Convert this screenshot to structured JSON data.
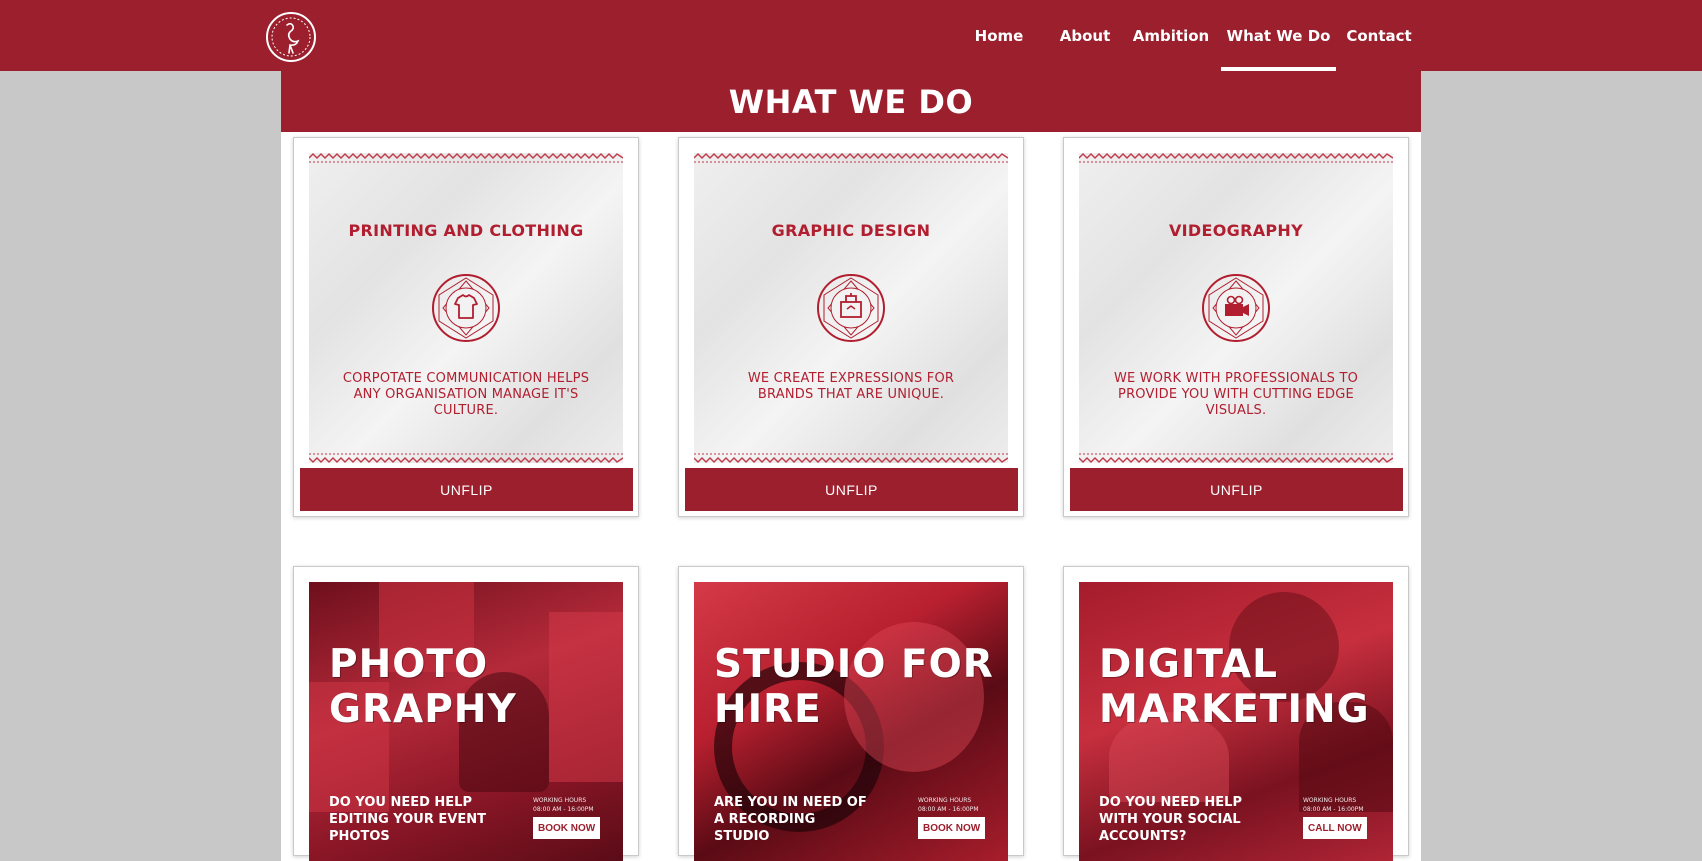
{
  "nav": {
    "items": [
      "Home",
      "About",
      "Ambition",
      "What We Do",
      "Contact"
    ],
    "active": "What We Do"
  },
  "section": {
    "title": "WHAT WE DO"
  },
  "services": [
    {
      "title": "PRINTING AND CLOTHING",
      "description": "CORPOTATE COMMUNICATION HELPS ANY ORGANISATION MANAGE IT'S CULTURE.",
      "button": "UNFLIP",
      "icon": "tshirt-icon"
    },
    {
      "title": "GRAPHIC DESIGN",
      "description": "WE CREATE EXPRESSIONS FOR BRANDS THAT ARE UNIQUE.",
      "button": "UNFLIP",
      "icon": "design-tool-icon"
    },
    {
      "title": "VIDEOGRAPHY",
      "description": "WE WORK WITH PROFESSIONALS TO PROVIDE YOU WITH CUTTING EDGE VISUALS.",
      "button": "UNFLIP",
      "icon": "video-camera-icon"
    }
  ],
  "posters": [
    {
      "title": "PHOTO GRAPHY",
      "title_line1": "PHOTO",
      "title_line2": "GRAPHY",
      "subtitle": "DO YOU NEED HELP EDITING YOUR EVENT PHOTOS",
      "hours_label": "WORKING HOURS",
      "hours": "08:00 AM - 16:00PM",
      "button": "BOOK NOW"
    },
    {
      "title": "STUDIO FOR HIRE",
      "title_line1": "STUDIO FOR",
      "title_line2": "HIRE",
      "subtitle": "ARE YOU IN NEED OF A RECORDING STUDIO",
      "hours_label": "WORKING HOURS",
      "hours": "08:00 AM - 16:00PM",
      "button": "BOOK NOW"
    },
    {
      "title": "DIGITAL MARKETING",
      "title_line1": "DIGITAL",
      "title_line2": "MARKETING",
      "subtitle": "DO YOU NEED HELP WITH YOUR SOCIAL ACCOUNTS?",
      "hours_label": "WORKING HOURS",
      "hours": "08:00 AM - 16:00PM",
      "button": "CALL NOW"
    }
  ],
  "colors": {
    "brand": "#9b1f2d",
    "accent": "#b11e2f",
    "page_bg": "#c8c8c8"
  }
}
